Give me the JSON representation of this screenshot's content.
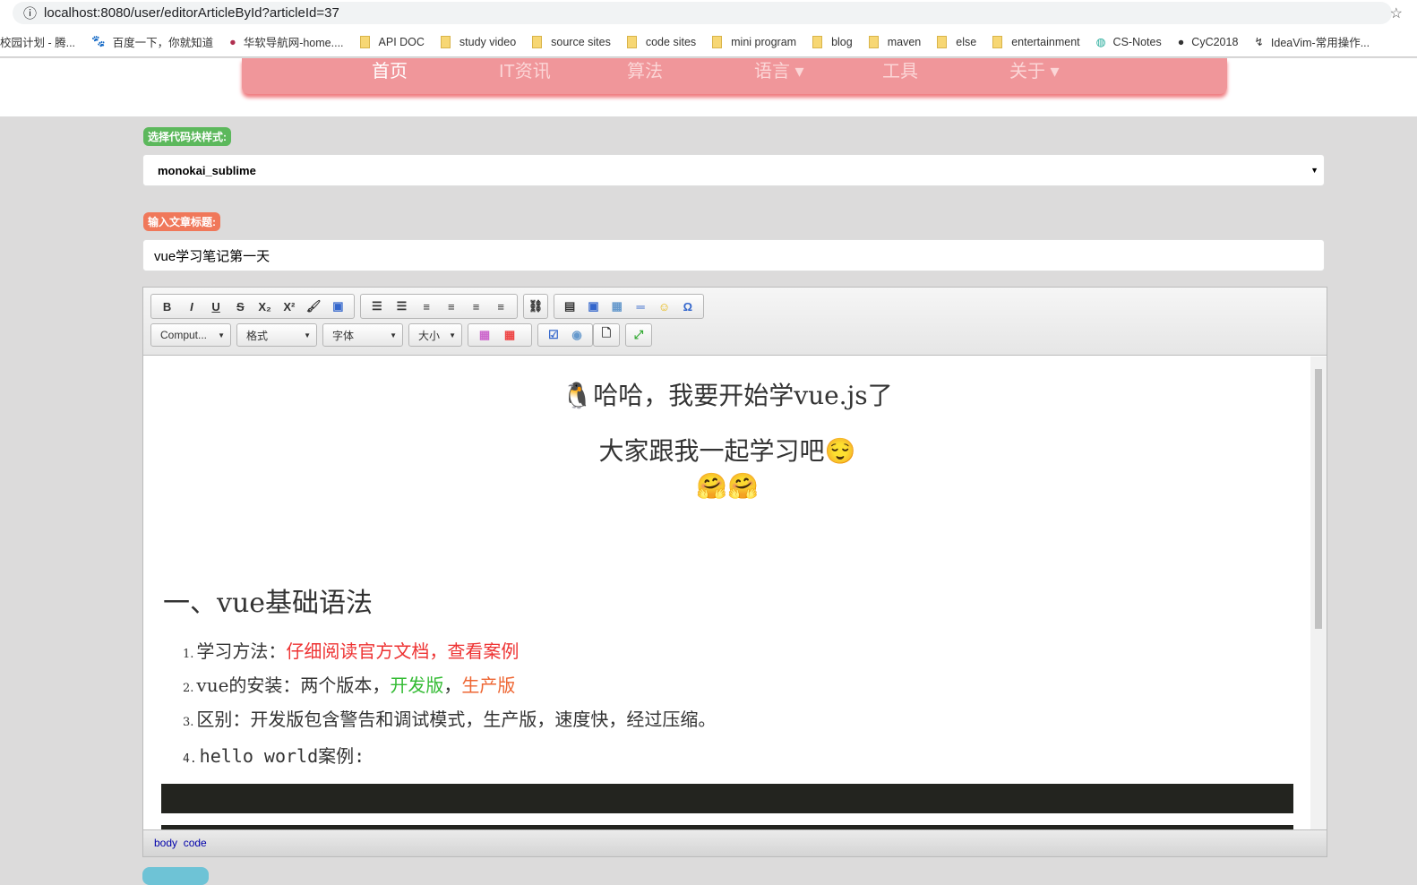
{
  "browser": {
    "url": "localhost:8080/user/editorArticleById?articleId=37",
    "bookmarks": [
      "校园计划 - 腾...",
      "百度一下，你就知道",
      "华软导航网-home....",
      "API DOC",
      "study video",
      "source sites",
      "code sites",
      "mini program",
      "blog",
      "maven",
      "else",
      "entertainment",
      "CS-Notes",
      "CyC2018",
      "IdeaVim-常用操作..."
    ]
  },
  "nav": [
    "首页",
    "IT资讯",
    "算法",
    "语言 ▾",
    "工具",
    "关于 ▾"
  ],
  "code_style": {
    "label": "选择代码块样式:",
    "value": "monokai_sublime"
  },
  "title_field": {
    "label": "输入文章标题:",
    "value": "vue学习笔记第一天"
  },
  "toolbar": {
    "combos": [
      "Comput...",
      "格式",
      "字体",
      "大小"
    ],
    "buttons": [
      "B",
      "I",
      "U",
      "S",
      "X₂",
      "X²"
    ]
  },
  "content": {
    "line1": "哈哈，我要开始学vue.js了",
    "line2": "大家跟我一起学习吧",
    "heading": "一、vue基础语法",
    "items": [
      {
        "n": "1.",
        "a": "学习方法：",
        "b": "仔细阅读官方文档，查看案例"
      },
      {
        "n": "2.",
        "a": "vue的安装：两个版本，",
        "b": "开发版",
        "c": "，",
        "d": "生产版"
      },
      {
        "n": "3.",
        "a": "区别：开发版包含警告和调试模式，生产版，速度快，经过压缩。"
      },
      {
        "n": "4.",
        "a": "hello world案例:"
      }
    ]
  },
  "footer": {
    "path": [
      "body",
      "code"
    ]
  }
}
